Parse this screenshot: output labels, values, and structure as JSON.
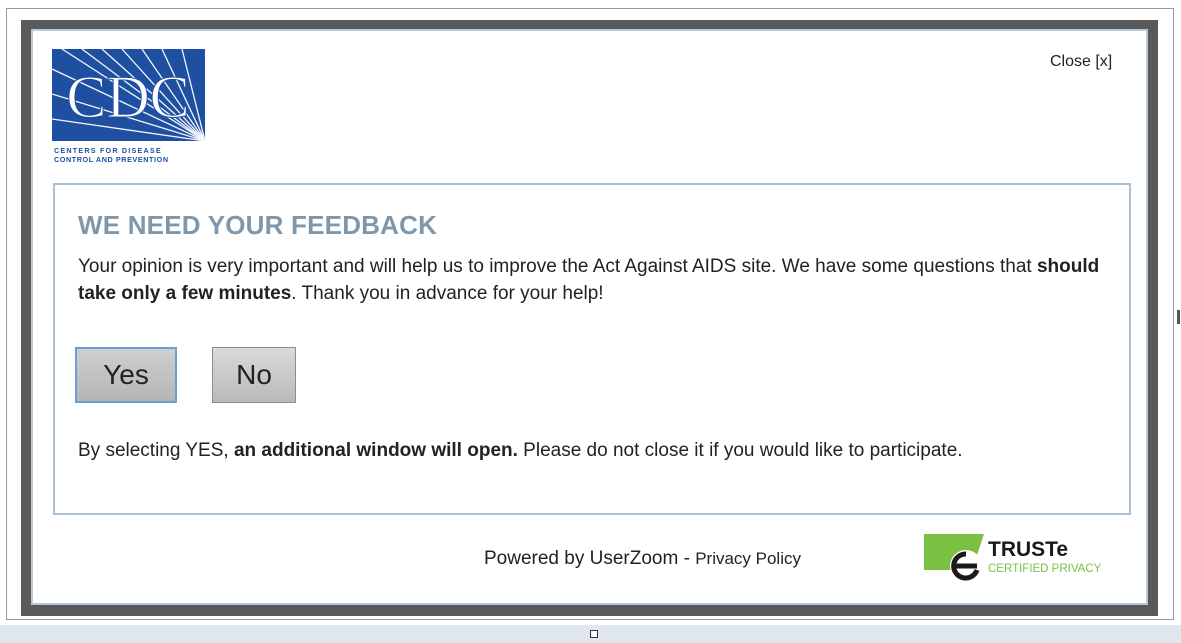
{
  "dialog": {
    "close_label": "Close [x]",
    "heading": "WE NEED YOUR FEEDBACK",
    "intro_part1": "Your opinion is very important and will help us to improve the Act Against AIDS site. We have some questions that ",
    "intro_bold": "should take only a few minutes",
    "intro_part2": ". Thank you in advance for your help!",
    "yes_label": "Yes",
    "no_label": "No",
    "note_part1": "By selecting YES, ",
    "note_bold": "an additional window will open.",
    "note_part2": " Please do not close it if you would like to participate."
  },
  "logo": {
    "letters": "CDC",
    "line1": "CENTERS FOR DISEASE",
    "line2": "CONTROL AND PREVENTION"
  },
  "footer": {
    "powered_by": "Powered by UserZoom - ",
    "privacy_link": "Privacy Policy",
    "truste_name": "TRUSTe",
    "truste_sub": "CERTIFIED PRIVACY"
  },
  "colors": {
    "cdc_blue": "#1f4fa1",
    "heading_gray_blue": "#7f97ab",
    "truste_green": "#7ac143"
  }
}
